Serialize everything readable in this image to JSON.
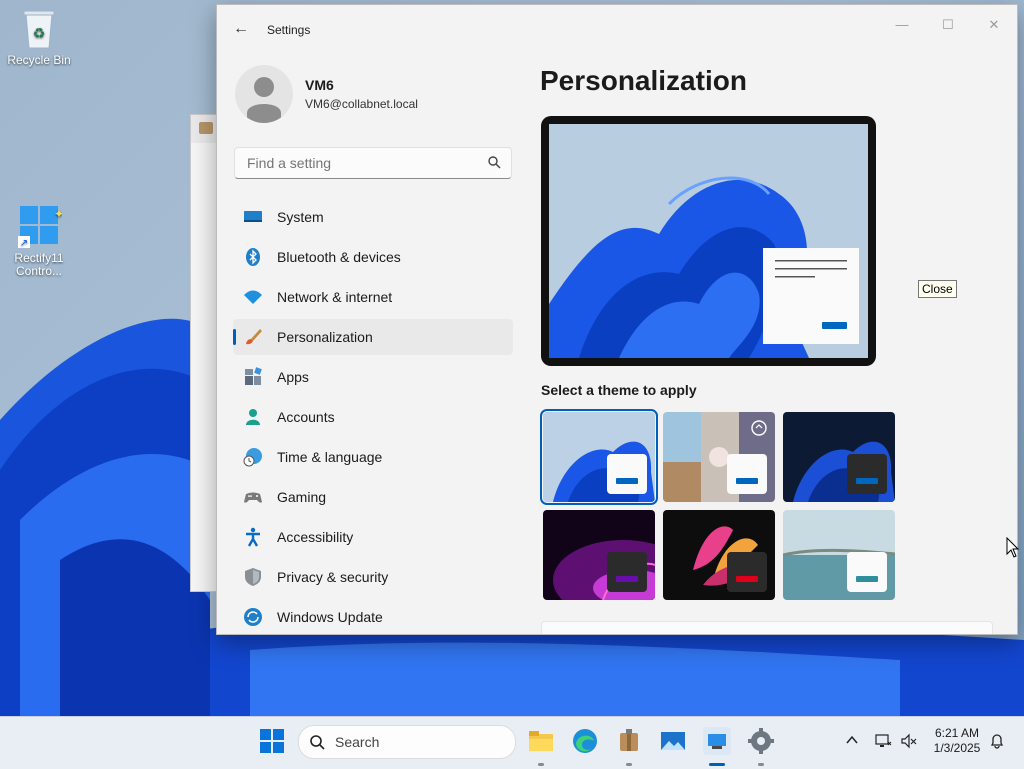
{
  "desktop": {
    "icons": [
      {
        "label": "Recycle Bin"
      },
      {
        "label": "Rectify11 Contro..."
      }
    ],
    "tooltip": "Close"
  },
  "window": {
    "title": "Settings",
    "user": {
      "name": "VM6",
      "email": "VM6@collabnet.local"
    },
    "search": {
      "placeholder": "Find a setting"
    },
    "nav": [
      {
        "label": "System",
        "icon": "system-icon",
        "active": false
      },
      {
        "label": "Bluetooth & devices",
        "icon": "bluetooth-icon",
        "active": false
      },
      {
        "label": "Network & internet",
        "icon": "wifi-icon",
        "active": false
      },
      {
        "label": "Personalization",
        "icon": "brush-icon",
        "active": true
      },
      {
        "label": "Apps",
        "icon": "apps-icon",
        "active": false
      },
      {
        "label": "Accounts",
        "icon": "person-icon",
        "active": false
      },
      {
        "label": "Time & language",
        "icon": "globe-clock-icon",
        "active": false
      },
      {
        "label": "Gaming",
        "icon": "gamepad-icon",
        "active": false
      },
      {
        "label": "Accessibility",
        "icon": "accessibility-icon",
        "active": false
      },
      {
        "label": "Privacy & security",
        "icon": "shield-icon",
        "active": false
      },
      {
        "label": "Windows Update",
        "icon": "update-icon",
        "active": false
      }
    ],
    "page": {
      "heading": "Personalization",
      "theme_label": "Select a theme to apply",
      "themes": [
        {
          "name": "windows-light",
          "selected": true,
          "accent": "#0067c0"
        },
        {
          "name": "windows-spotlight",
          "selected": false,
          "accent": "#0067c0"
        },
        {
          "name": "windows-dark",
          "selected": false,
          "accent": "#0067c0"
        },
        {
          "name": "glow",
          "selected": false,
          "accent": "#6a0dad"
        },
        {
          "name": "captured-motion",
          "selected": false,
          "accent": "#e0001b"
        },
        {
          "name": "flow",
          "selected": false,
          "accent": "#2f8f9d"
        }
      ]
    }
  },
  "taskbar": {
    "search_label": "Search",
    "time": "6:21 AM",
    "date": "1/3/2025"
  },
  "colors": {
    "accent": "#005fb8"
  }
}
